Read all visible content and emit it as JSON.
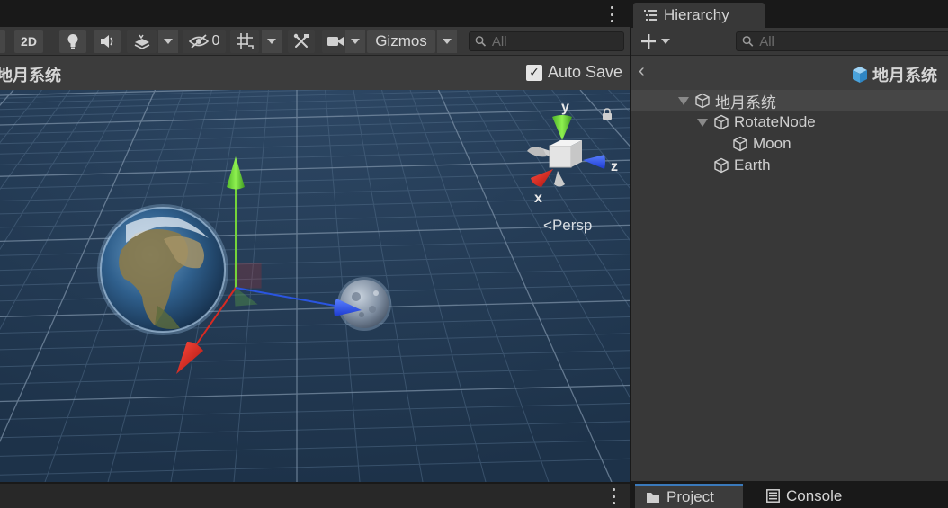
{
  "scene_toolbar": {
    "two_d_label": "2D",
    "hidden_count": "0",
    "gizmos_label": "Gizmos",
    "search_placeholder": "All"
  },
  "scene_header": {
    "title": "地月系统",
    "auto_save_label": "Auto Save",
    "auto_save_checked": true
  },
  "viewport": {
    "axis_x": "x",
    "axis_y": "y",
    "axis_z": "z",
    "projection_label": "Persp",
    "colors": {
      "grid_bg": "#22384f",
      "x_axis": "#d82a22",
      "y_axis": "#74d33a",
      "z_axis": "#2a55e0"
    }
  },
  "hierarchy": {
    "tab_label": "Hierarchy",
    "search_placeholder": "All",
    "scene_name": "地月系统",
    "tree": [
      {
        "label": "地月系统",
        "depth": 0,
        "expanded": true
      },
      {
        "label": "RotateNode",
        "depth": 1,
        "expanded": true
      },
      {
        "label": "Moon",
        "depth": 2
      },
      {
        "label": "Earth",
        "depth": 1
      }
    ]
  },
  "bottom_tabs": {
    "project_label": "Project",
    "console_label": "Console"
  },
  "accent_color": "#3a79bb"
}
